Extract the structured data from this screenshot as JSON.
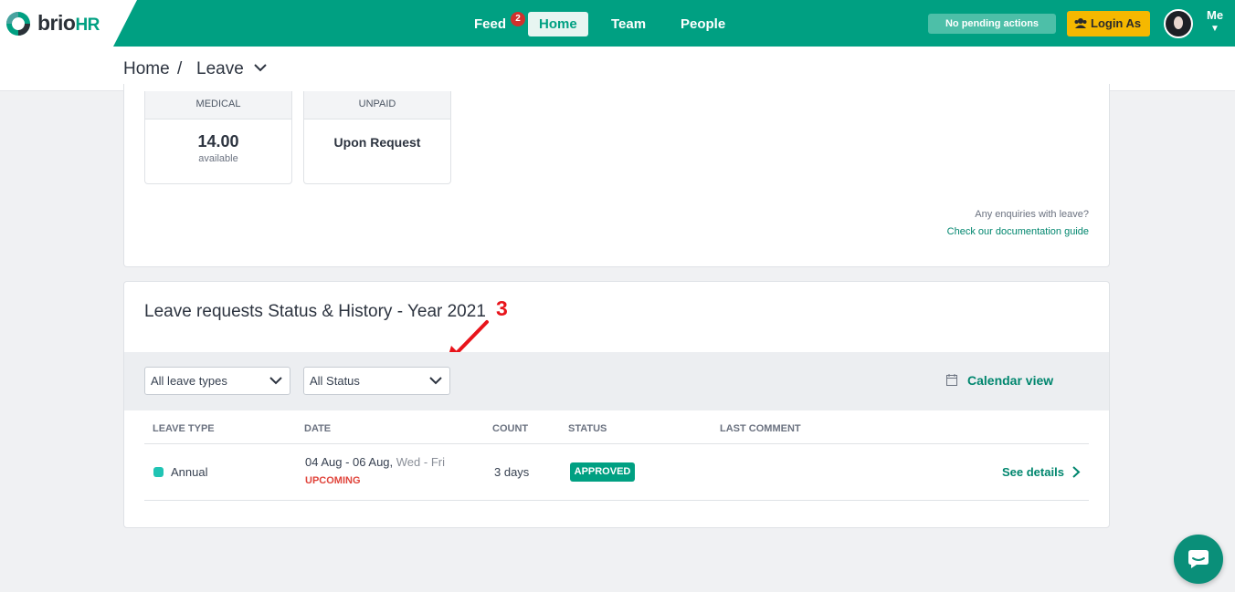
{
  "header": {
    "logo": {
      "brand": "brio",
      "suffix": "HR"
    },
    "nav": [
      {
        "label": "Feed",
        "badge": "2"
      },
      {
        "label": "Home",
        "active": true
      },
      {
        "label": "Team"
      },
      {
        "label": "People"
      }
    ],
    "pending_label": "No pending actions",
    "login_as_label": "Login As",
    "user_label": "Me",
    "accent_color": "#00a082"
  },
  "breadcrumb": {
    "root": "Home",
    "separator": "/",
    "current": "Leave"
  },
  "balances": [
    {
      "type": "MEDICAL",
      "value": "14.00",
      "sub": "available"
    },
    {
      "type": "UNPAID",
      "value": "Upon Request"
    }
  ],
  "help": {
    "question": "Any enquiries with leave?",
    "link": "Check our documentation guide"
  },
  "requests": {
    "title": "Leave requests Status & History - Year 2021",
    "annotation": "3",
    "filters": {
      "leave_type": "All leave types",
      "status": "All Status"
    },
    "calendar_view_label": "Calendar view",
    "columns": [
      "LEAVE TYPE",
      "DATE",
      "COUNT",
      "STATUS",
      "LAST COMMENT"
    ],
    "rows": [
      {
        "leave_type": "Annual",
        "date_range": "04 Aug - 06 Aug,",
        "day_range": "Wed - Fri",
        "timing": "UPCOMING",
        "count": "3 days",
        "status": "APPROVED",
        "last_comment": "",
        "action": "See details"
      }
    ]
  }
}
